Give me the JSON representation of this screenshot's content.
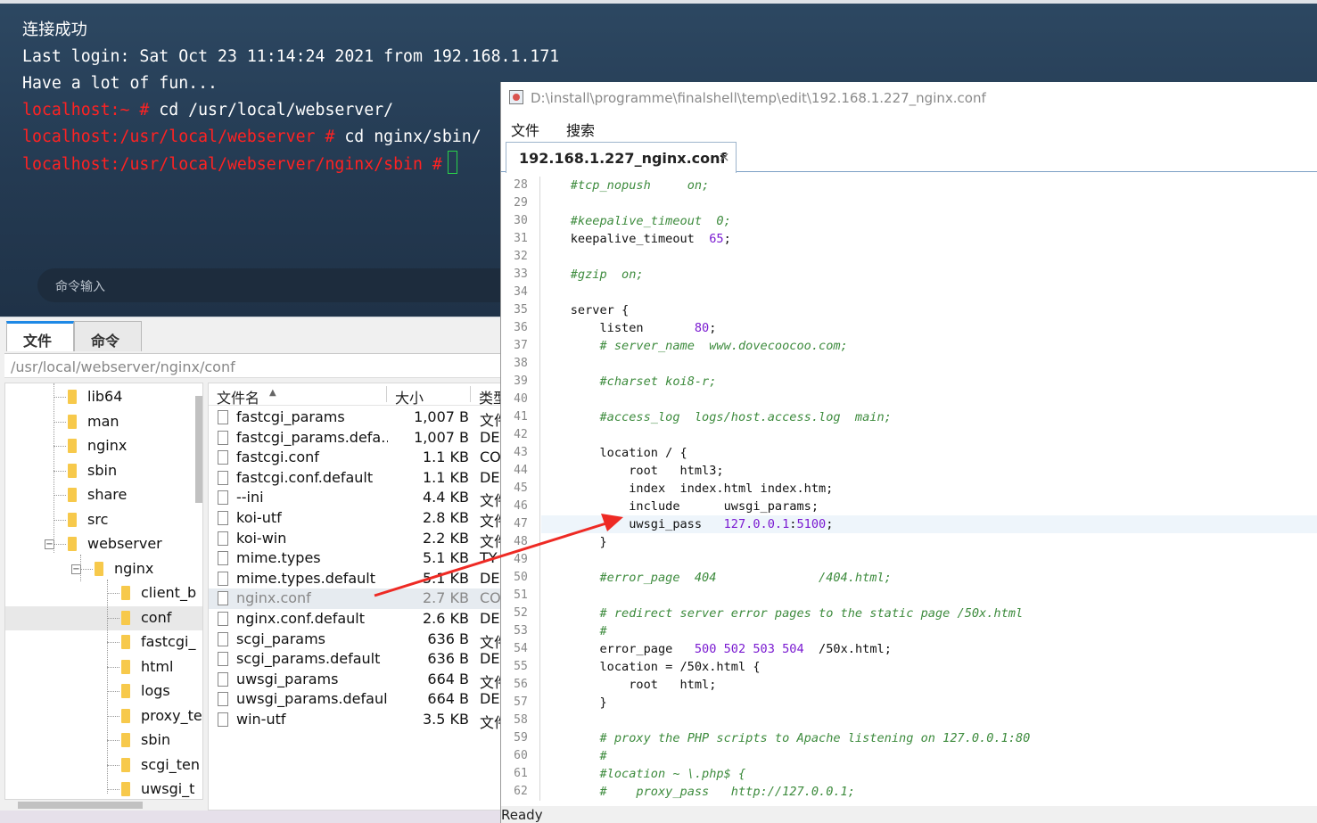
{
  "terminal": {
    "lines": [
      {
        "prompt": "",
        "text": "连接成功"
      },
      {
        "prompt": "",
        "text": "Last login: Sat Oct 23 11:14:24 2021 from 192.168.1.171"
      },
      {
        "prompt": "",
        "text": "Have a lot of fun..."
      },
      {
        "prompt": "localhost:~ #",
        "text": " cd /usr/local/webserver/"
      },
      {
        "prompt": "localhost:/usr/local/webserver #",
        "text": " cd nginx/sbin/"
      },
      {
        "prompt": "localhost:/usr/local/webserver/nginx/sbin #",
        "text": ""
      }
    ],
    "command_placeholder": "命令输入"
  },
  "file_manager": {
    "tabs": [
      "文件",
      "命令"
    ],
    "path": "/usr/local/webserver/nginx/conf",
    "tree": [
      {
        "label": "lib64",
        "level": 1
      },
      {
        "label": "man",
        "level": 1
      },
      {
        "label": "nginx",
        "level": 1
      },
      {
        "label": "sbin",
        "level": 1
      },
      {
        "label": "share",
        "level": 1
      },
      {
        "label": "src",
        "level": 1
      },
      {
        "label": "webserver",
        "level": 1,
        "expanded": true
      },
      {
        "label": "nginx",
        "level": 2,
        "expanded": true
      },
      {
        "label": "client_b",
        "level": 3
      },
      {
        "label": "conf",
        "level": 3,
        "selected": true
      },
      {
        "label": "fastcgi_",
        "level": 3
      },
      {
        "label": "html",
        "level": 3
      },
      {
        "label": "logs",
        "level": 3
      },
      {
        "label": "proxy_te",
        "level": 3
      },
      {
        "label": "sbin",
        "level": 3
      },
      {
        "label": "scgi_ten",
        "level": 3
      },
      {
        "label": "uwsgi_t",
        "level": 3
      }
    ],
    "columns": {
      "name": "文件名",
      "size": "大小",
      "type": "类型"
    },
    "files": [
      {
        "name": "fastcgi_params",
        "size": "1,007 B",
        "type": "文件"
      },
      {
        "name": "fastcgi_params.defa...",
        "size": "1,007 B",
        "type": "DE"
      },
      {
        "name": "fastcgi.conf",
        "size": "1.1 KB",
        "type": "CO"
      },
      {
        "name": "fastcgi.conf.default",
        "size": "1.1 KB",
        "type": "DE"
      },
      {
        "name": "--ini",
        "size": "4.4 KB",
        "type": "文件"
      },
      {
        "name": "koi-utf",
        "size": "2.8 KB",
        "type": "文件"
      },
      {
        "name": "koi-win",
        "size": "2.2 KB",
        "type": "文件"
      },
      {
        "name": "mime.types",
        "size": "5.1 KB",
        "type": "TY"
      },
      {
        "name": "mime.types.default",
        "size": "5.1 KB",
        "type": "DE"
      },
      {
        "name": "nginx.conf",
        "size": "2.7 KB",
        "type": "CO",
        "selected": true
      },
      {
        "name": "nginx.conf.default",
        "size": "2.6 KB",
        "type": "DE"
      },
      {
        "name": "scgi_params",
        "size": "636 B",
        "type": "文件"
      },
      {
        "name": "scgi_params.default",
        "size": "636 B",
        "type": "DE"
      },
      {
        "name": "uwsgi_params",
        "size": "664 B",
        "type": "文件"
      },
      {
        "name": "uwsgi_params.default",
        "size": "664 B",
        "type": "DE"
      },
      {
        "name": "win-utf",
        "size": "3.5 KB",
        "type": "文件"
      }
    ]
  },
  "editor": {
    "title": "D:\\install\\programme\\finalshell\\temp\\edit\\192.168.1.227_nginx.conf",
    "menu": [
      "文件",
      "搜索"
    ],
    "tab_name": "192.168.1.227_nginx.conf",
    "tab_close": "×",
    "highlight_line": 47,
    "lines": [
      {
        "n": "28",
        "t": "    #tcp_nopush     on;"
      },
      {
        "n": "29",
        "t": ""
      },
      {
        "n": "30",
        "t": "    #keepalive_timeout  0;"
      },
      {
        "n": "31",
        "t": "    keepalive_timeout  65;"
      },
      {
        "n": "32",
        "t": ""
      },
      {
        "n": "33",
        "t": "    #gzip  on;"
      },
      {
        "n": "34",
        "t": ""
      },
      {
        "n": "35",
        "t": "    server {"
      },
      {
        "n": "36",
        "t": "        listen       80;"
      },
      {
        "n": "37",
        "t": "        # server_name  www.dovecoocoo.com;"
      },
      {
        "n": "38",
        "t": ""
      },
      {
        "n": "39",
        "t": "        #charset koi8-r;"
      },
      {
        "n": "40",
        "t": ""
      },
      {
        "n": "41",
        "t": "        #access_log  logs/host.access.log  main;"
      },
      {
        "n": "42",
        "t": ""
      },
      {
        "n": "43",
        "t": "        location / {"
      },
      {
        "n": "44",
        "t": "            root   html3;"
      },
      {
        "n": "45",
        "t": "            index  index.html index.htm;"
      },
      {
        "n": "46",
        "t": "            include      uwsgi_params;"
      },
      {
        "n": "47",
        "t": "            uwsgi_pass   127.0.0.1:5100;"
      },
      {
        "n": "48",
        "t": "        }"
      },
      {
        "n": "49",
        "t": ""
      },
      {
        "n": "50",
        "t": "        #error_page  404              /404.html;"
      },
      {
        "n": "51",
        "t": ""
      },
      {
        "n": "52",
        "t": "        # redirect server error pages to the static page /50x.html"
      },
      {
        "n": "53",
        "t": "        #"
      },
      {
        "n": "54",
        "t": "        error_page   500 502 503 504  /50x.html;"
      },
      {
        "n": "55",
        "t": "        location = /50x.html {"
      },
      {
        "n": "56",
        "t": "            root   html;"
      },
      {
        "n": "57",
        "t": "        }"
      },
      {
        "n": "58",
        "t": ""
      },
      {
        "n": "59",
        "t": "        # proxy the PHP scripts to Apache listening on 127.0.0.1:80"
      },
      {
        "n": "60",
        "t": "        #"
      },
      {
        "n": "61",
        "t": "        #location ~ \\.php$ {"
      },
      {
        "n": "62",
        "t": "        #    proxy_pass   http://127.0.0.1;"
      }
    ],
    "status": "Ready"
  },
  "colors": {
    "terminal_prompt": "#ff2222",
    "comment": "#3d8b3d",
    "number": "#7a1ad1",
    "arrow": "#ee2a24",
    "accent": "#1e88e5"
  }
}
